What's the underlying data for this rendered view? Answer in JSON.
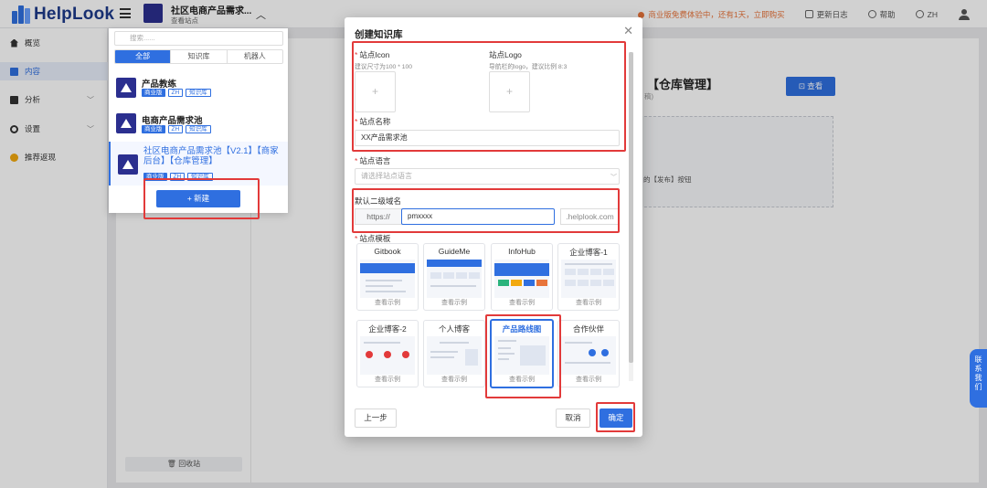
{
  "header": {
    "logo_text": "HelpLook",
    "site_title": "社区电商产品需求...",
    "site_sub": "查看站点",
    "promo": "商业版免费体验中，还有1天，立即购买",
    "changelog": "更新日志",
    "help": "帮助",
    "lang": "ZH"
  },
  "sidebar": {
    "items": [
      {
        "label": "概览"
      },
      {
        "label": "内容"
      },
      {
        "label": "分析"
      },
      {
        "label": "设置"
      },
      {
        "label": "推荐返现"
      }
    ]
  },
  "dropdown": {
    "search_placeholder": "搜索......",
    "tabs": [
      "全部",
      "知识库",
      "机器人"
    ],
    "items": [
      {
        "title": "产品教练",
        "tags": [
          "商业版",
          "ZH",
          "知识库"
        ]
      },
      {
        "title": "电商产品需求池",
        "tags": [
          "商业版",
          "ZH",
          "知识库"
        ]
      },
      {
        "title": "社区电商产品需求池【V2.1】【商家后台】【仓库管理】",
        "tags": [
          "商业版",
          "ZH",
          "知识库"
        ]
      }
    ],
    "new_button": "+ 新建"
  },
  "background": {
    "heading": "【仓库管理】",
    "heading_sub": "稿)",
    "view_button": "查看",
    "hint_text": "的【发布】按钮",
    "recycle": "回收站"
  },
  "modal": {
    "title": "创建知识库",
    "site_icon_label": "站点Icon",
    "site_icon_hint": "建议尺寸为100 * 100",
    "site_logo_label": "站点Logo",
    "site_logo_hint": "导航栏的logo，建议比例 8:3",
    "upload_plus": "+",
    "site_name_label": "站点名称",
    "site_name_value": "XX产品需求池",
    "site_lang_label": "站点语言",
    "site_lang_placeholder": "请选择站点语言",
    "subdomain_label": "默认二级域名",
    "subdomain_prefix": "https://",
    "subdomain_value": "pmxxxx",
    "subdomain_suffix": ".helplook.com",
    "template_label": "站点模板",
    "templates": [
      {
        "name": "Gitbook",
        "link": "查看示例"
      },
      {
        "name": "GuideMe",
        "link": "查看示例"
      },
      {
        "name": "InfoHub",
        "link": "查看示例"
      },
      {
        "name": "企业博客-1",
        "link": "查看示例"
      },
      {
        "name": "企业博客-2",
        "link": "查看示例"
      },
      {
        "name": "个人博客",
        "link": "查看示例"
      },
      {
        "name": "产品路线图",
        "link": "查看示例"
      },
      {
        "name": "合作伙伴",
        "link": "查看示例"
      }
    ],
    "prev_button": "上一步",
    "cancel_button": "取消",
    "confirm_button": "确定"
  },
  "float_contact": [
    "联",
    "系",
    "我",
    "们"
  ],
  "colors": {
    "primary": "#2f6fe0",
    "highlight": "#e23a3a",
    "promo": "#e8743b"
  }
}
